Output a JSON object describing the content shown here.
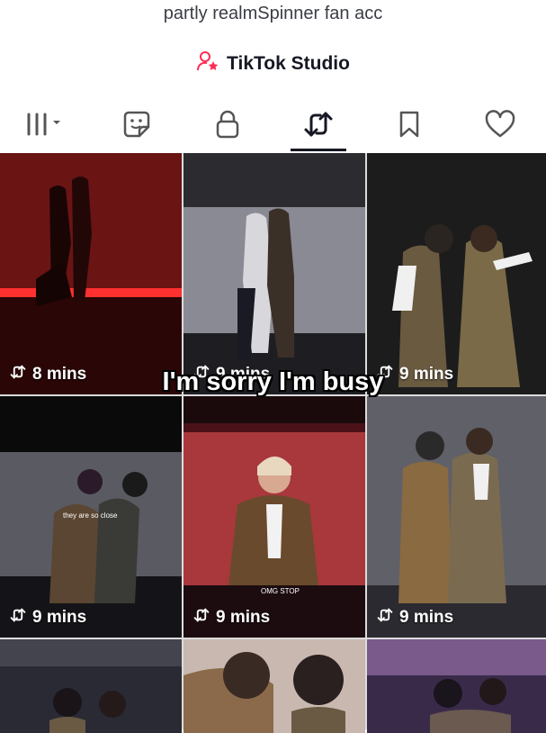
{
  "profile": {
    "bio": "partly realmSpinner fan acc",
    "studio_label": "TikTok Studio"
  },
  "tabs": [
    {
      "name": "videos",
      "icon": "grid-icon",
      "active": false
    },
    {
      "name": "stickers",
      "icon": "sticker-icon",
      "active": false
    },
    {
      "name": "private",
      "icon": "lock-icon",
      "active": false
    },
    {
      "name": "reposts",
      "icon": "repost-icon",
      "active": true
    },
    {
      "name": "favorites",
      "icon": "bookmark-icon",
      "active": false
    },
    {
      "name": "liked",
      "icon": "heart-icon",
      "active": false
    }
  ],
  "videos": [
    {
      "time": "8 mins"
    },
    {
      "time": "9 mins"
    },
    {
      "time": "9 mins"
    },
    {
      "time": "9 mins",
      "overlay": "they are so close"
    },
    {
      "time": "9 mins",
      "overlay": "OMG STOP"
    },
    {
      "time": "9 mins"
    },
    {
      "time": ""
    },
    {
      "time": ""
    },
    {
      "time": ""
    }
  ],
  "caption": "I'm sorry I'm busy",
  "colors": {
    "accent": "#fe2c55",
    "text": "#161823"
  }
}
